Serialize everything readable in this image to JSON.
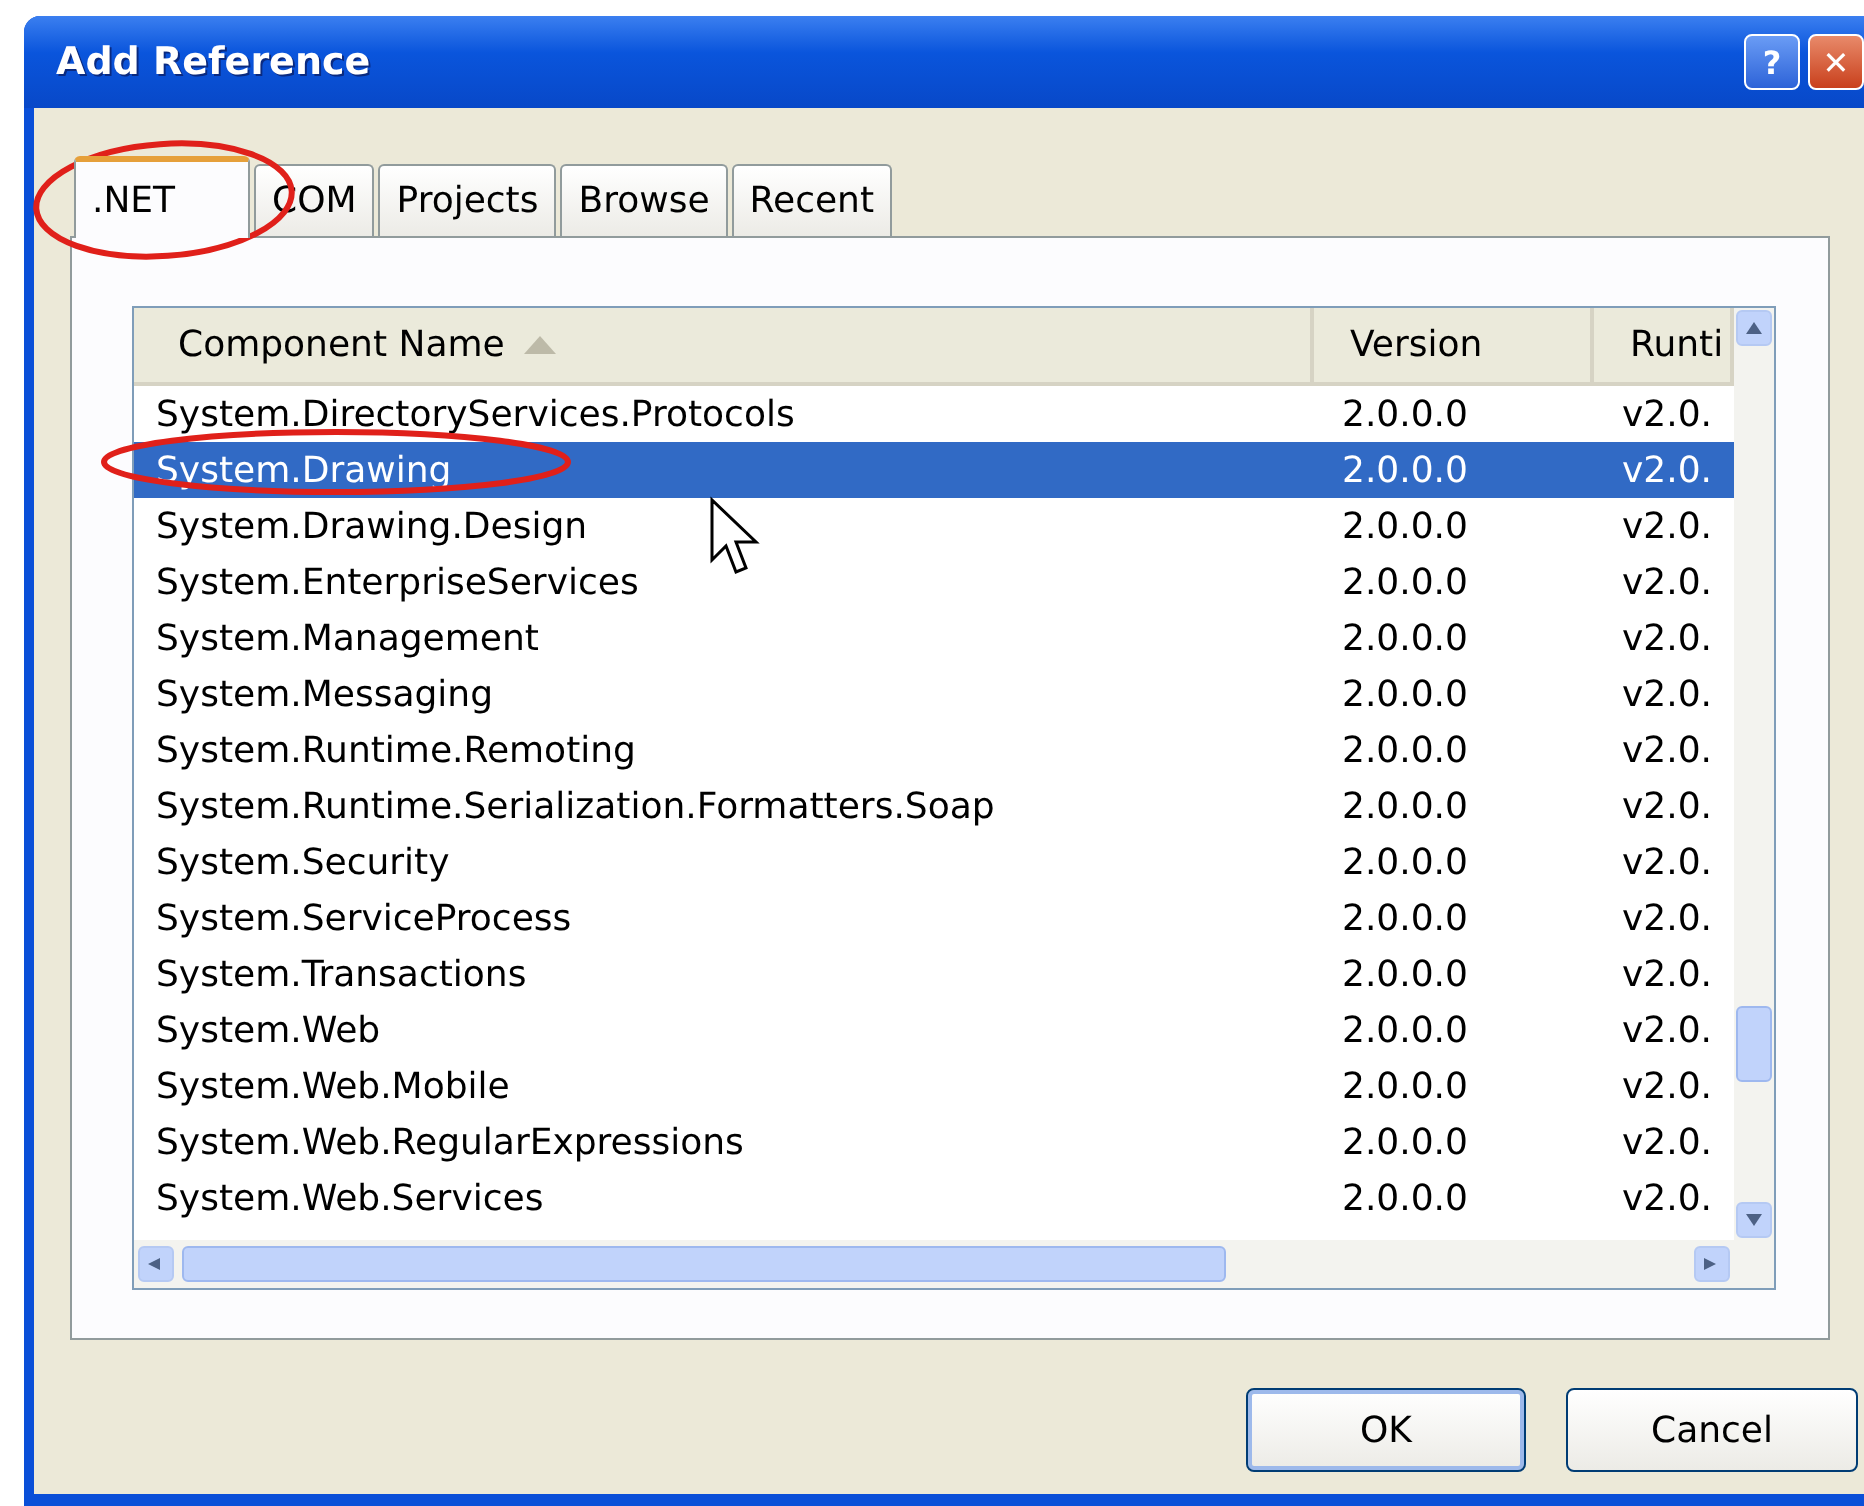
{
  "window": {
    "title": "Add Reference"
  },
  "title_buttons": [
    {
      "kind": "help",
      "label": "?"
    },
    {
      "kind": "close",
      "label": "✕"
    }
  ],
  "tabs": [
    {
      "label": ".NET",
      "selected": true
    },
    {
      "label": "COM",
      "selected": false
    },
    {
      "label": "Projects",
      "selected": false
    },
    {
      "label": "Browse",
      "selected": false
    },
    {
      "label": "Recent",
      "selected": false
    }
  ],
  "table": {
    "columns": [
      {
        "label": "Component Name",
        "sorted": true
      },
      {
        "label": "Version",
        "sorted": false
      },
      {
        "label": "Runti",
        "sorted": false
      }
    ],
    "rows": [
      {
        "cells": [
          "System.DirectoryServices.Protocols",
          "2.0.0.0",
          "v2.0."
        ],
        "selected": false
      },
      {
        "cells": [
          "System.Drawing",
          "2.0.0.0",
          "v2.0."
        ],
        "selected": true
      },
      {
        "cells": [
          "System.Drawing.Design",
          "2.0.0.0",
          "v2.0."
        ],
        "selected": false
      },
      {
        "cells": [
          "System.EnterpriseServices",
          "2.0.0.0",
          "v2.0."
        ],
        "selected": false
      },
      {
        "cells": [
          "System.Management",
          "2.0.0.0",
          "v2.0."
        ],
        "selected": false
      },
      {
        "cells": [
          "System.Messaging",
          "2.0.0.0",
          "v2.0."
        ],
        "selected": false
      },
      {
        "cells": [
          "System.Runtime.Remoting",
          "2.0.0.0",
          "v2.0."
        ],
        "selected": false
      },
      {
        "cells": [
          "System.Runtime.Serialization.Formatters.Soap",
          "2.0.0.0",
          "v2.0."
        ],
        "selected": false
      },
      {
        "cells": [
          "System.Security",
          "2.0.0.0",
          "v2.0."
        ],
        "selected": false
      },
      {
        "cells": [
          "System.ServiceProcess",
          "2.0.0.0",
          "v2.0."
        ],
        "selected": false
      },
      {
        "cells": [
          "System.Transactions",
          "2.0.0.0",
          "v2.0."
        ],
        "selected": false
      },
      {
        "cells": [
          "System.Web",
          "2.0.0.0",
          "v2.0."
        ],
        "selected": false
      },
      {
        "cells": [
          "System.Web.Mobile",
          "2.0.0.0",
          "v2.0."
        ],
        "selected": false
      },
      {
        "cells": [
          "System.Web.RegularExpressions",
          "2.0.0.0",
          "v2.0."
        ],
        "selected": false
      },
      {
        "cells": [
          "System.Web.Services",
          "2.0.0.0",
          "v2.0."
        ],
        "selected": false
      }
    ]
  },
  "buttons": [
    {
      "label": "OK",
      "default": true
    },
    {
      "label": "Cancel",
      "default": false
    }
  ]
}
